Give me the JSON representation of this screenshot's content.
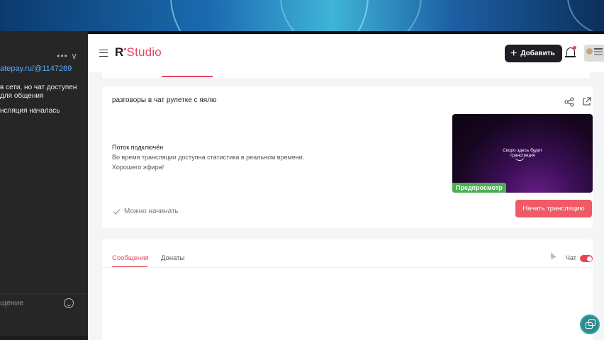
{
  "chat_window": {
    "controls": "••• ∨",
    "link": "atepay.ru/@1147269",
    "messages": [
      "в сети, но чат доступен",
      "для общения",
      "нсляция началась"
    ],
    "input_placeholder": "щение"
  },
  "header": {
    "logo_r": "R",
    "logo_dot": "•",
    "logo_studio": "Studio",
    "add_button": "Добавить",
    "add_icon": "plus-icon"
  },
  "stream_card": {
    "title": "разговоры в чат рулетке с яялю",
    "status_title": "Поток подключён",
    "status_lines": [
      "Во время трансляции доступна статистика в реальном времени.",
      "Хорошего эфира!"
    ],
    "ready_text": "Можно начинать",
    "preview_text_1": "Скоро здесь будет",
    "preview_text_2": "трансляция",
    "preview_badge": "Предпросмотр",
    "start_button": "Начать трансляцию"
  },
  "messages_panel": {
    "tabs": [
      "Сообщения",
      "Донаты"
    ],
    "chat_toggle_label": "Чат",
    "chat_enabled": true
  },
  "colors": {
    "accent": "#e8455a",
    "start_button": "#ef5a66",
    "preview_badge": "#4caf50",
    "header_button": "#1e1e24",
    "fab": "#2d8c8c"
  }
}
